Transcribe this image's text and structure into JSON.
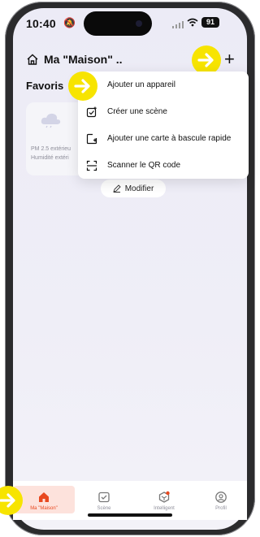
{
  "status_bar": {
    "time": "10:40",
    "battery": "91"
  },
  "header": {
    "title": "Ma \"Maison\" ..",
    "section": "Favoris"
  },
  "weather_card": {
    "line1": "PM 2.5 extérieu",
    "line2": "Humidité extéri"
  },
  "modifier_label": "Modifier",
  "menu": {
    "items": [
      {
        "label": "Ajouter un appareil",
        "icon": "add-device-icon"
      },
      {
        "label": "Créer une scène",
        "icon": "create-scene-icon"
      },
      {
        "label": "Ajouter une carte à bascule rapide",
        "icon": "add-card-icon"
      },
      {
        "label": "Scanner le QR code",
        "icon": "qr-scan-icon"
      }
    ]
  },
  "tabs": [
    {
      "label": "Ma \"Maison\"",
      "icon": "home-icon",
      "active": true
    },
    {
      "label": "Scène",
      "icon": "scene-icon",
      "active": false
    },
    {
      "label": "Intelligent",
      "icon": "intelligent-icon",
      "active": false
    },
    {
      "label": "Profil",
      "icon": "profile-icon",
      "active": false
    }
  ],
  "colors": {
    "accent": "#e8481f",
    "highlight": "#f7e400",
    "active_tab_bg": "#fde2dc"
  }
}
